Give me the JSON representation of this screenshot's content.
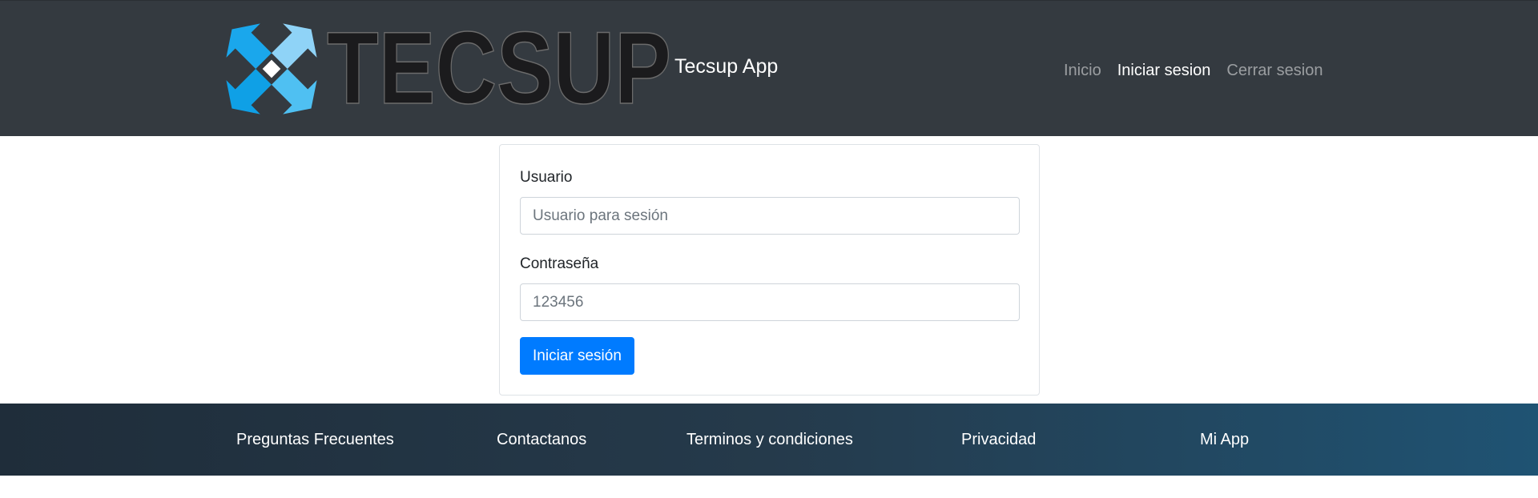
{
  "header": {
    "logo_text": "TECSUP",
    "brand_name": "Tecsup App",
    "nav": [
      {
        "label": "Inicio",
        "active": false
      },
      {
        "label": "Iniciar sesion",
        "active": true
      },
      {
        "label": "Cerrar sesion",
        "active": false
      }
    ],
    "colors": {
      "background": "#343a40",
      "logo_blue": "#1aa7ec",
      "logo_light_blue": "#8fd3f7"
    }
  },
  "form": {
    "username_label": "Usuario",
    "username_placeholder": "Usuario para sesión",
    "username_value": "",
    "password_label": "Contraseña",
    "password_placeholder": "123456",
    "password_value": "",
    "submit_label": "Iniciar sesión",
    "colors": {
      "primary": "#007bff"
    }
  },
  "footer": {
    "links": [
      "Preguntas Frecuentes",
      "Contactanos",
      "Terminos y condiciones",
      "Privacidad",
      "Mi App"
    ]
  }
}
